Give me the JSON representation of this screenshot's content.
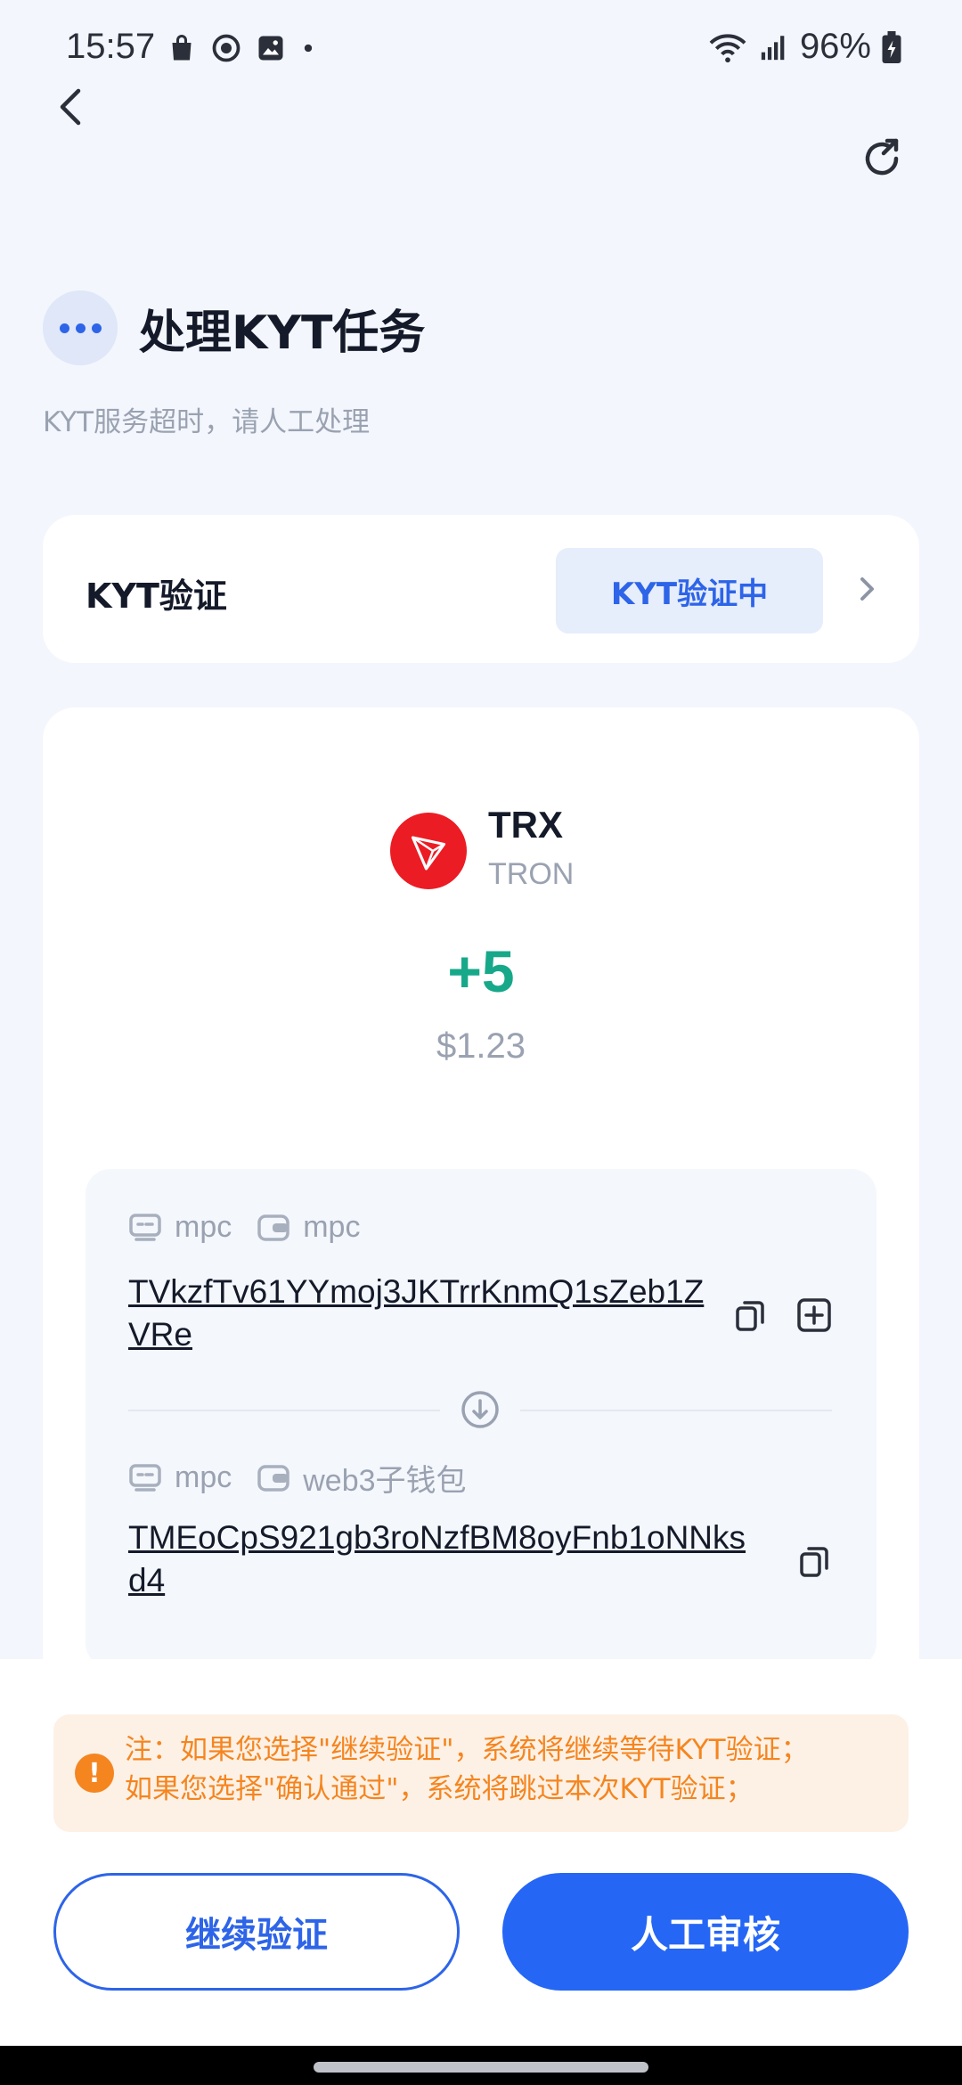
{
  "status_bar": {
    "time": "15:57",
    "battery": "96%",
    "left_icons": [
      "shopping-bag-icon",
      "sync-icon",
      "image-icon",
      "dot-icon"
    ]
  },
  "header": {
    "title": "处理KYT任务",
    "subtitle": "KYT服务超时，请人工处理"
  },
  "kyt": {
    "label": "KYT验证",
    "status": "KYT验证中"
  },
  "transaction": {
    "token_symbol": "TRX",
    "token_chain": "TRON",
    "amount": "+5",
    "amount_usd": "$1.23",
    "from": {
      "tag1": "mpc",
      "tag2": "mpc",
      "address": "TVkzfTv61YYmoj3JKTrrKnmQ1sZeb1ZVRe"
    },
    "to": {
      "tag1": "mpc",
      "tag2": "web3子钱包",
      "address": "TMEoCpS921gb3roNzfBM8oyFnb1oNNksd4"
    }
  },
  "notice": {
    "line1": "注：如果您选择\"继续验证\"，系统将继续等待KYT验证；",
    "line2": "如果您选择\"确认通过\"，系统将跳过本次KYT验证；"
  },
  "actions": {
    "continue_label": "继续验证",
    "manual_label": "人工审核"
  },
  "colors": {
    "accent": "#2566f5",
    "amount_positive": "#17a88a",
    "warning": "#f5851f",
    "tron_red": "#ec1c24"
  }
}
